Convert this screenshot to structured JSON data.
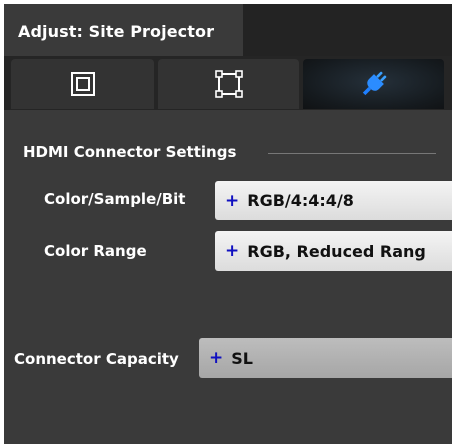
{
  "window": {
    "title": "Adjust: Site Projector"
  },
  "tabs": [
    {
      "icon": "square-frame-icon"
    },
    {
      "icon": "corner-handles-icon"
    },
    {
      "icon": "plug-icon",
      "selected": true
    }
  ],
  "section": {
    "title": "HDMI Connector Settings"
  },
  "fields": {
    "color_sample_bit": {
      "label": "Color/Sample/Bit",
      "prefix": "+",
      "value": "RGB/4:4:4/8"
    },
    "color_range": {
      "label": "Color Range",
      "prefix": "+",
      "value": "RGB, Reduced Rang"
    },
    "connector_capacity": {
      "label": "Connector Capacity",
      "prefix": "+",
      "value": "SL"
    }
  },
  "colors": {
    "panel_bg": "#3a3a3a",
    "tabbar_bg": "#252525",
    "accent_blue": "#1e90ff",
    "plus_blue": "#1010c0"
  }
}
